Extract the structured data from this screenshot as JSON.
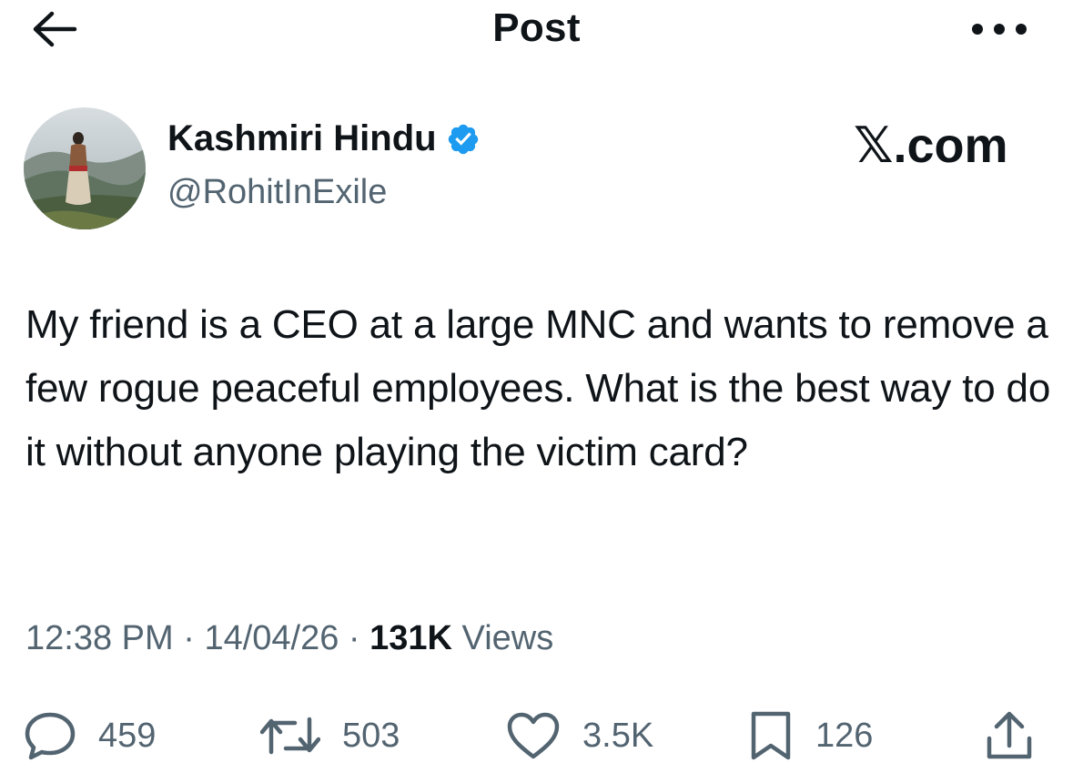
{
  "header": {
    "title": "Post"
  },
  "author": {
    "name": "Kashmiri Hindu",
    "handle": "@RohitInExile"
  },
  "watermark": {
    "logo": "𝕏",
    "domain": ".com"
  },
  "post": {
    "text": "My friend is a CEO at a large MNC and wants to remove a few rogue peaceful employees. What is the best way to do it without anyone playing the victim card?"
  },
  "meta": {
    "time": "12:38 PM",
    "separator": "·",
    "date": "14/04/26",
    "views_count": "131K",
    "views_label": "Views"
  },
  "actions": {
    "replies": "459",
    "reposts": "503",
    "likes": "3.5K",
    "bookmarks": "126"
  },
  "icons": {
    "back": "arrow-left-icon",
    "more": "more-horizontal-icon",
    "verified": "verified-badge-icon",
    "reply": "reply-bubble-icon",
    "repost": "repost-icon",
    "like": "heart-icon",
    "bookmark": "bookmark-icon",
    "share": "share-upload-icon"
  },
  "colors": {
    "text": "#0f1419",
    "secondary": "#536471",
    "verified": "#1d9bf0"
  }
}
